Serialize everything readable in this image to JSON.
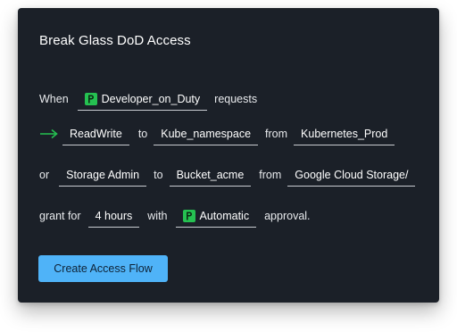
{
  "card": {
    "title": "Break Glass DoD Access"
  },
  "row1": {
    "when": "When",
    "schedule": "Developer_on_Duty",
    "schedule_icon": "pagerduty-icon",
    "requests": "requests"
  },
  "row2": {
    "arrow_icon": "arrow-right-icon",
    "permission": "ReadWrite",
    "to": "to",
    "resource": "Kube_namespace",
    "from": "from",
    "source": "Kubernetes_Prod"
  },
  "row3": {
    "or": "or",
    "permission": "Storage Admin",
    "to": "to",
    "resource": "Bucket_acme",
    "from": "from",
    "source": "Google Cloud Storage/"
  },
  "row4": {
    "grant_for": "grant for",
    "duration": "4 hours",
    "with": "with",
    "approval": "Automatic",
    "approval_icon": "pagerduty-icon",
    "approval_suffix": "approval."
  },
  "button": {
    "label": "Create Access Flow"
  },
  "colors": {
    "card_bg": "#1b2028",
    "accent_green": "#25c151",
    "button_bg": "#4fb3f8"
  }
}
